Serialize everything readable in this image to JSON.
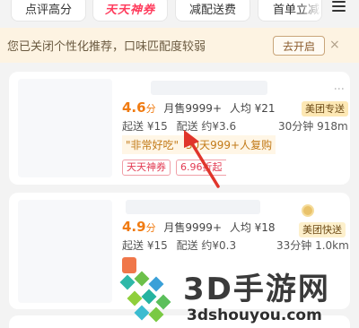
{
  "filters": [
    {
      "label": "点评高分"
    },
    {
      "label": "天天神券"
    },
    {
      "label": "减配送费"
    },
    {
      "label": "首单立减"
    }
  ],
  "notice": {
    "text": "您已关闭个性化推荐，口味匹配度较弱",
    "button": "去开启",
    "close": "×"
  },
  "cards": [
    {
      "score_value": "4.6",
      "score_unit": "分",
      "sales": "月售9999+",
      "avg": "人均 ¥21",
      "delivery_tag": "美团专送",
      "min_order": "起送 ¥15",
      "delivery_fee": "配送 约¥3.6",
      "time_distance": "30分钟 918m",
      "quote": "\"非常好吃\"",
      "repurchase": "30天999+人复购",
      "badge1": "天天神券",
      "badge2": "6.96折起"
    },
    {
      "score_value": "4.9",
      "score_unit": "分",
      "sales": "月售9999+",
      "avg": "人均 ¥18",
      "delivery_tag": "美团快送",
      "min_order": "起送 ¥15",
      "delivery_fee": "配送 约¥0.3",
      "time_distance": "33分钟 1.0km"
    }
  ],
  "watermark": {
    "big": "3D手游网",
    "small": "3dshouyou.com"
  },
  "colors": {
    "accent_orange": "#f07b12",
    "brand_red": "#ff3b5c",
    "arrow_red": "#e0352b",
    "notice_bg": "#fdf3e2"
  }
}
